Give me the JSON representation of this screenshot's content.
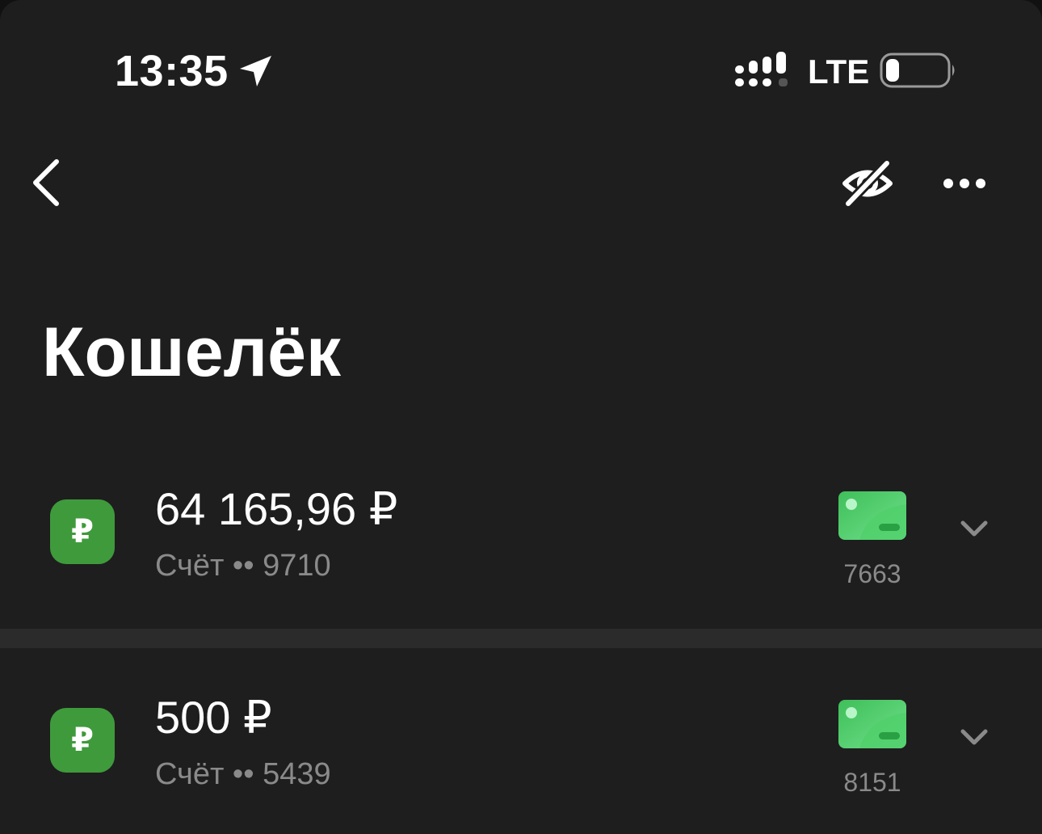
{
  "status_bar": {
    "time": "13:35",
    "network": "LTE",
    "icons": [
      "location-arrow-icon",
      "signal-icon",
      "battery-icon"
    ]
  },
  "nav": {
    "icons": [
      "chevron-left-icon",
      "eye-slash-icon",
      "ellipsis-icon"
    ]
  },
  "page": {
    "title": "Кошелёк"
  },
  "accounts": [
    {
      "currency_symbol": "₽",
      "balance": "64 165,96 ₽",
      "label": "Счёт •• 9710",
      "card_number": "7663",
      "icon": "ruble-icon"
    },
    {
      "currency_symbol": "₽",
      "balance": "500 ₽",
      "label": "Счёт •• 5439",
      "card_number": "8151",
      "icon": "ruble-icon"
    }
  ],
  "colors": {
    "background": "#1e1e1e",
    "divider": "#2b2b2b",
    "accent_green": "#3f9a3c",
    "secondary_text": "#8a8a8a"
  }
}
